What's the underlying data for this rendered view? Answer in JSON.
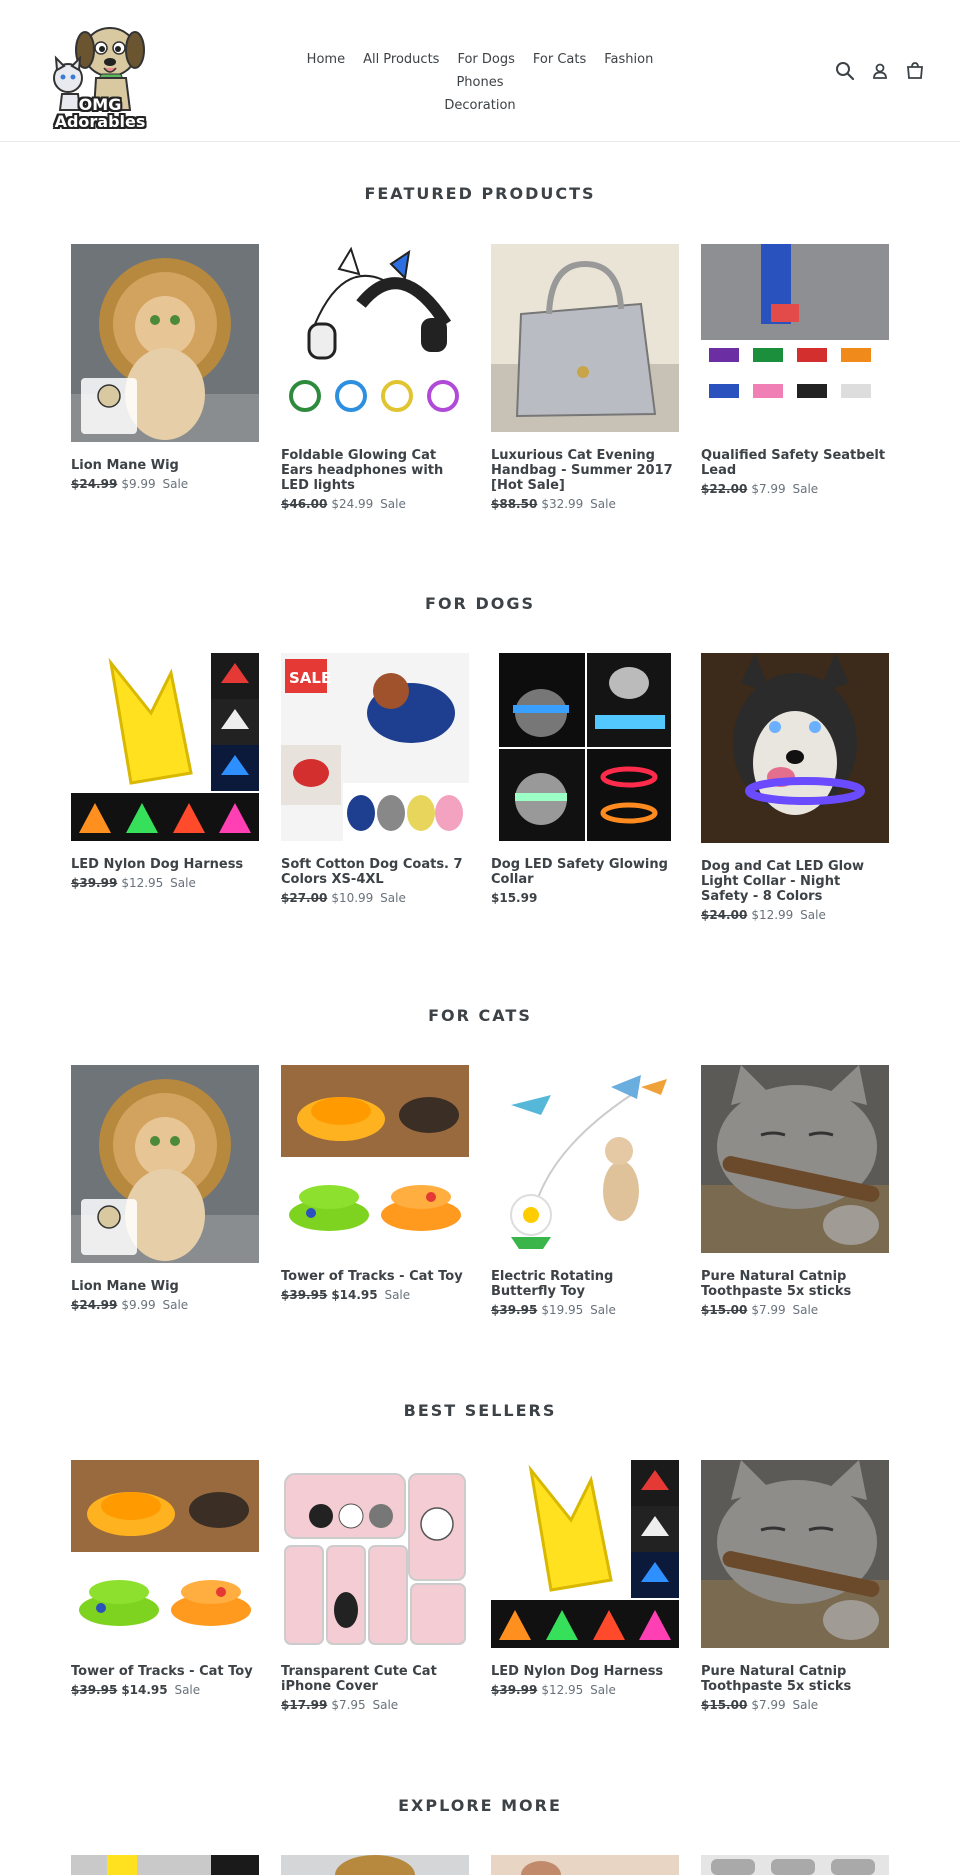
{
  "brand": {
    "name": "OMG Adorables"
  },
  "nav": {
    "items": [
      "Home",
      "All Products",
      "For Dogs",
      "For Cats",
      "Fashion",
      "Phones",
      "Decoration"
    ]
  },
  "sections": [
    {
      "title": "FEATURED PRODUCTS",
      "products": [
        {
          "title": "Lion Mane Wig",
          "old_price": "$24.99",
          "price": "$9.99",
          "sale": "Sale"
        },
        {
          "title": "Foldable Glowing Cat Ears headphones with LED lights",
          "old_price": "$46.00",
          "price": "$24.99",
          "sale": "Sale"
        },
        {
          "title": "Luxurious Cat Evening Handbag - Summer 2017 [Hot Sale]",
          "old_price": "$88.50",
          "price": "$32.99",
          "sale": "Sale"
        },
        {
          "title": "Qualified Safety Seatbelt Lead",
          "old_price": "$22.00",
          "price": "$7.99",
          "sale": "Sale"
        }
      ]
    },
    {
      "title": "FOR DOGS",
      "products": [
        {
          "title": "LED Nylon Dog Harness",
          "old_price": "$39.99",
          "price": "$12.95",
          "sale": "Sale"
        },
        {
          "title": "Soft Cotton Dog Coats. 7 Colors XS-4XL",
          "old_price": "$27.00",
          "price": "$10.99",
          "sale": "Sale"
        },
        {
          "title": "Dog LED Safety Glowing Collar",
          "old_price": "",
          "price": "$15.99",
          "sale": ""
        },
        {
          "title": "Dog and Cat LED Glow Light Collar - Night Safety - 8 Colors",
          "old_price": "$24.00",
          "price": "$12.99",
          "sale": "Sale"
        }
      ]
    },
    {
      "title": "FOR CATS",
      "products": [
        {
          "title": "Lion Mane Wig",
          "old_price": "$24.99",
          "price": "$9.99",
          "sale": "Sale"
        },
        {
          "title": "Tower of Tracks - Cat Toy",
          "old_price": "$39.95",
          "price": "$14.95",
          "sale": "Sale"
        },
        {
          "title": "Electric Rotating Butterfly Toy",
          "old_price": "$39.95",
          "price": "$19.95",
          "sale": "Sale"
        },
        {
          "title": "Pure Natural Catnip Toothpaste 5x sticks",
          "old_price": "$15.00",
          "price": "$7.99",
          "sale": "Sale"
        }
      ]
    },
    {
      "title": "BEST SELLERS",
      "products": [
        {
          "title": "Tower of Tracks - Cat Toy",
          "old_price": "$39.95",
          "price": "$14.95",
          "sale": "Sale"
        },
        {
          "title": "Transparent Cute Cat iPhone Cover",
          "old_price": "$17.99",
          "price": "$7.95",
          "sale": "Sale"
        },
        {
          "title": "LED Nylon Dog Harness",
          "old_price": "$39.99",
          "price": "$12.95",
          "sale": "Sale"
        },
        {
          "title": "Pure Natural Catnip Toothpaste 5x sticks",
          "old_price": "$15.00",
          "price": "$7.99",
          "sale": "Sale"
        }
      ]
    },
    {
      "title": "EXPLORE MORE",
      "products": []
    }
  ],
  "icons": [
    "search-icon",
    "account-icon",
    "cart-icon"
  ]
}
